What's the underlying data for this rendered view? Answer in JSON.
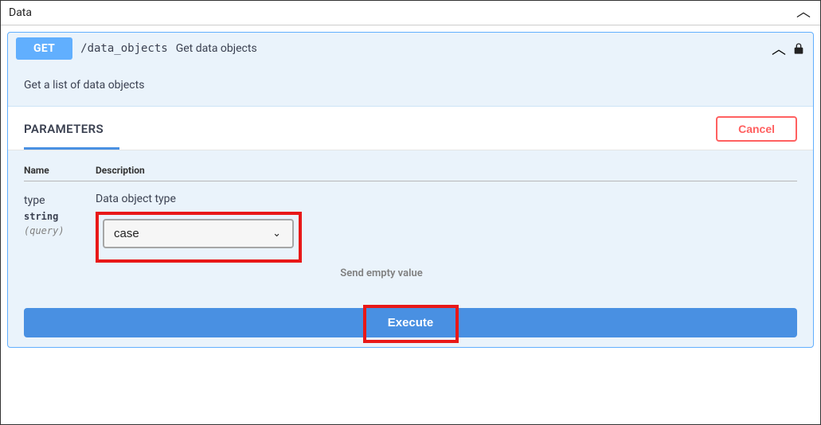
{
  "section": {
    "title": "Data"
  },
  "operation": {
    "method": "GET",
    "path": "/data_objects",
    "summary": "Get data objects",
    "description": "Get a list of data objects"
  },
  "parameters": {
    "heading": "PARAMETERS",
    "cancel_label": "Cancel",
    "col_name": "Name",
    "col_desc": "Description",
    "items": [
      {
        "name": "type",
        "data_type": "string",
        "in": "(query)",
        "description": "Data object type",
        "selected_value": "case"
      }
    ],
    "send_empty_label": "Send empty value"
  },
  "actions": {
    "execute_label": "Execute"
  }
}
